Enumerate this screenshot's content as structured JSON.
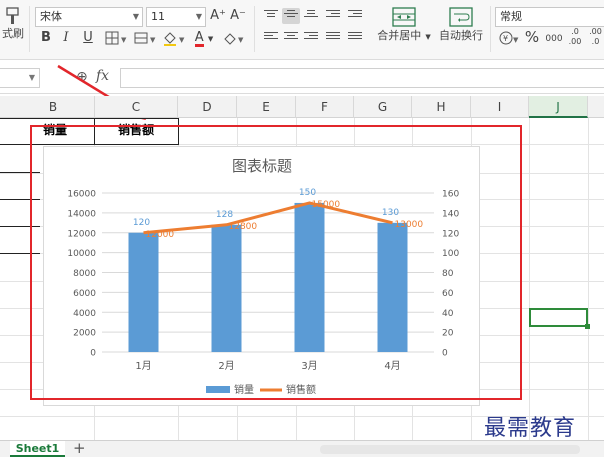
{
  "ribbon": {
    "format_painter_label": "式刷",
    "font_name": "宋体",
    "font_size": "11",
    "grow_font": "A⁺",
    "shrink_font": "A⁻",
    "bold": "B",
    "italic": "I",
    "underline": "U",
    "font_color_glyph": "A",
    "merge_center_label": "合并居中",
    "wrap_text_label": "自动换行",
    "number_format": "常规",
    "percent": "%",
    "comma_style": "000",
    "inc_decimal": ".0 .00",
    "dec_decimal": ".00 .0",
    "accent_red": "#e2262b"
  },
  "formula_bar": {
    "fx_label": "fx",
    "zoom_glyph": "⊕"
  },
  "columns": [
    "B",
    "C",
    "D",
    "E",
    "F",
    "G",
    "H",
    "I",
    "J"
  ],
  "cells": {
    "sales_header": "销量",
    "revenue_header": "销售额"
  },
  "sheet_tabs": {
    "active": "Sheet1",
    "add": "+"
  },
  "watermark": "最需教育",
  "chart_data": {
    "type": "bar",
    "title": "图表标题",
    "categories": [
      "1月",
      "2月",
      "3月",
      "4月"
    ],
    "series": [
      {
        "name": "销量",
        "type": "bar",
        "axis": "right",
        "values": [
          120,
          128,
          150,
          130
        ],
        "color": "#5b9bd5"
      },
      {
        "name": "销售额",
        "type": "line",
        "axis": "left",
        "values": [
          12000,
          12800,
          15000,
          13000
        ],
        "color": "#ed7d31"
      }
    ],
    "left_axis": {
      "min": 0,
      "max": 16000,
      "ticks": [
        "0",
        "2000",
        "4000",
        "6000",
        "8000",
        "10000",
        "12000",
        "14000",
        "16000"
      ]
    },
    "right_axis": {
      "min": 0,
      "max": 160,
      "ticks": [
        "0",
        "20",
        "40",
        "60",
        "80",
        "100",
        "120",
        "140",
        "160"
      ]
    },
    "data_labels": {
      "bar": [
        "120",
        "128",
        "150",
        "130"
      ],
      "line": [
        "12000",
        "12800",
        "15000",
        "13000"
      ]
    },
    "legend_position": "bottom",
    "grid": true
  }
}
